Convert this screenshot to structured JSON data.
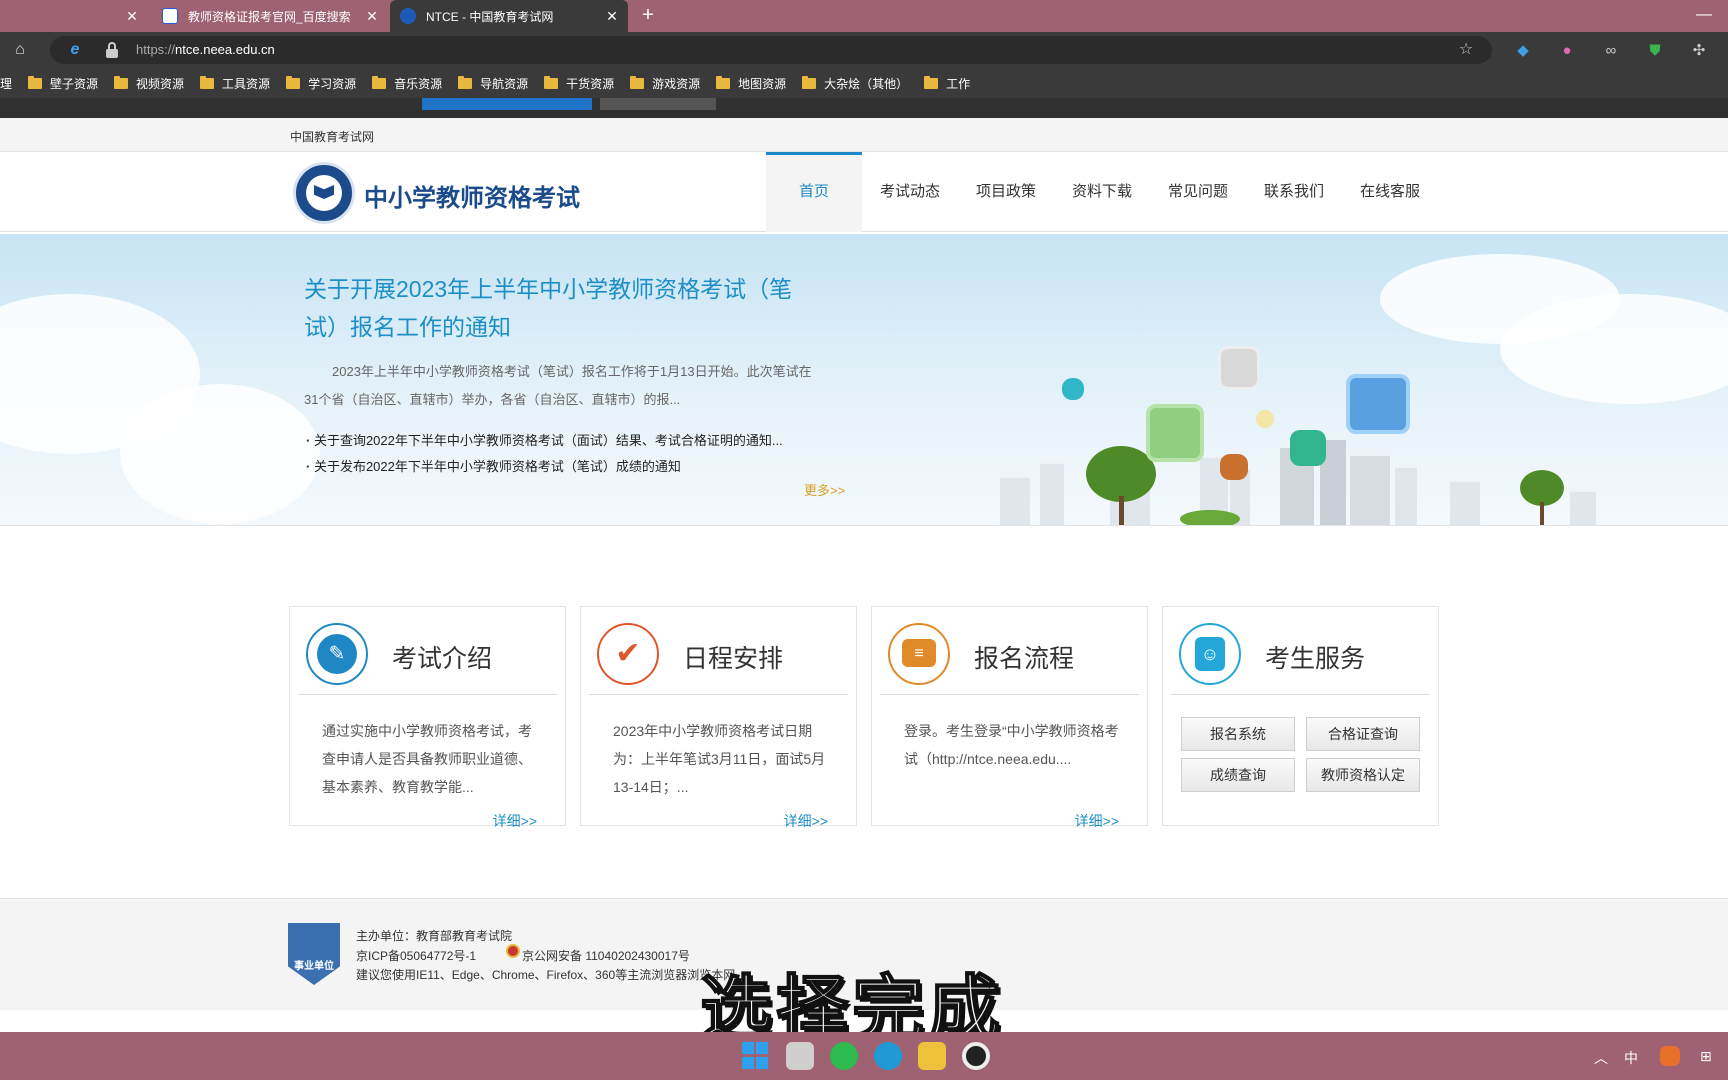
{
  "browser": {
    "tabs": [
      {
        "label": ""
      },
      {
        "label": "教师资格证报考官网_百度搜索"
      },
      {
        "label": "NTCE - 中国教育考试网"
      }
    ],
    "url_protocol": "https://",
    "url_host": "ntce.neea.edu.cn",
    "bookmarks": [
      "理",
      "壁子资源",
      "视频资源",
      "工具资源",
      "学习资源",
      "音乐资源",
      "导航资源",
      "干货资源",
      "游戏资源",
      "地图资源",
      "大杂烩（其他）",
      "工作"
    ]
  },
  "site": {
    "crumb": "中国教育考试网",
    "logo_text": "中小学教师资格考试",
    "nav": [
      "首页",
      "考试动态",
      "项目政策",
      "资料下载",
      "常见问题",
      "联系我们",
      "在线客服"
    ]
  },
  "banner": {
    "title": "关于开展2023年上半年中小学教师资格考试（笔试）报名工作的通知",
    "desc": "2023年上半年中小学教师资格考试（笔试）报名工作将于1月13日开始。此次笔试在31个省（自治区、直辖市）举办，各省（自治区、直辖市）的报...",
    "links": [
      "关于查询2022年下半年中小学教师资格考试（面试）结果、考试合格证明的通知...",
      "关于发布2022年下半年中小学教师资格考试（笔试）成绩的通知"
    ],
    "more": "更多>>"
  },
  "cards": [
    {
      "title": "考试介绍",
      "body": "通过实施中小学教师资格考试，考查申请人是否具备教师职业道德、基本素养、教育教学能...",
      "detail": "详细>>",
      "icon": "document-edit-icon"
    },
    {
      "title": "日程安排",
      "body": "2023年中小学教师资格考试日期为：上半年笔试3月11日，面试5月13-14日；...",
      "detail": "详细>>",
      "icon": "checkmark-icon"
    },
    {
      "title": "报名流程",
      "body": "登录。考生登录“中小学教师资格考试（http://ntce.neea.edu....",
      "detail": "详细>>",
      "icon": "registration-form-icon"
    },
    {
      "title": "考生服务",
      "services": [
        "报名系统",
        "合格证查询",
        "成绩查询",
        "教师资格认定"
      ],
      "icon": "contact-book-icon"
    }
  ],
  "footer": {
    "badge": "事业单位",
    "sponsor": "主办单位：教育部教育考试院",
    "icp": "京ICP备05064772号-1",
    "police": "京公网安备 11040202430017号",
    "browser_tip": "建议您使用IE11、Edge、Chrome、Firefox、360等主流浏览器浏览本网"
  },
  "overlay_caption": "选择完成",
  "taskbar": {
    "tray_ime": "中"
  }
}
